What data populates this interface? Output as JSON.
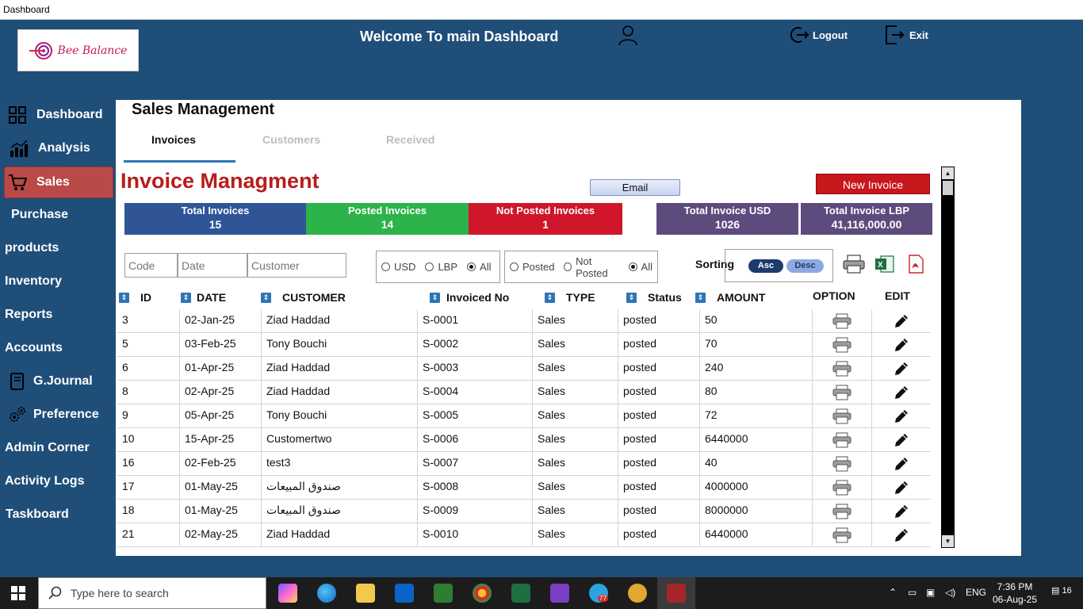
{
  "window": {
    "title": "Dashboard"
  },
  "header": {
    "logo_text": "Bee Balance",
    "welcome": "Welcome To main Dashboard",
    "logout": "Logout",
    "exit": "Exit"
  },
  "sidebar": {
    "items": [
      {
        "label": "Dashboard",
        "icon": "grid-icon"
      },
      {
        "label": "Analysis",
        "icon": "chart-icon"
      },
      {
        "label": "Sales",
        "icon": "cart-icon",
        "active": true
      },
      {
        "label": "Purchase",
        "icon": ""
      },
      {
        "label": "products",
        "icon": ""
      },
      {
        "label": "Inventory",
        "icon": ""
      },
      {
        "label": "Reports",
        "icon": ""
      },
      {
        "label": "Accounts",
        "icon": ""
      },
      {
        "label": "G.Journal",
        "icon": "book-icon"
      },
      {
        "label": "Preference",
        "icon": "gears-icon"
      },
      {
        "label": "Admin Corner",
        "icon": ""
      },
      {
        "label": "Activity Logs",
        "icon": ""
      },
      {
        "label": "Taskboard",
        "icon": ""
      }
    ]
  },
  "main": {
    "section_title": "Sales Management",
    "tabs": [
      {
        "label": "Invoices",
        "active": true
      },
      {
        "label": "Customers",
        "active": false
      },
      {
        "label": "Received",
        "active": false
      }
    ],
    "invoice_title": "Invoice Managment",
    "email_button": "Email",
    "new_invoice_button": "New Invoice",
    "stats": [
      {
        "label": "Total Invoices",
        "value": "15",
        "color": "#2f5597"
      },
      {
        "label": "Posted Invoices",
        "value": "14",
        "color": "#2cb34a"
      },
      {
        "label": "Not Posted Invoices",
        "value": "1",
        "color": "#d0162b"
      },
      {
        "label": "Total Invoice USD",
        "value": "1026",
        "color": "#5e4b7d"
      },
      {
        "label": "Total Invoice LBP",
        "value": "41,116,000.00",
        "color": "#5e4b7d"
      }
    ],
    "filters": {
      "code_placeholder": "Code",
      "date_placeholder": "Date",
      "customer_placeholder": "Customer",
      "currency": [
        {
          "label": "USD",
          "checked": false
        },
        {
          "label": "LBP",
          "checked": false
        },
        {
          "label": "All",
          "checked": true
        }
      ],
      "status": [
        {
          "label": "Posted",
          "checked": false
        },
        {
          "label": "Not Posted",
          "checked": false
        },
        {
          "label": "All",
          "checked": true
        }
      ],
      "sorting_label": "Sorting",
      "asc": "Asc",
      "desc": "Desc"
    },
    "columns": {
      "id": "ID",
      "date": "DATE",
      "customer": "CUSTOMER",
      "invoiced_no": "Invoiced No",
      "type": "TYPE",
      "status": "Status",
      "amount": "AMOUNT",
      "option": "OPTION",
      "edit": "EDIT"
    },
    "rows": [
      {
        "id": "3",
        "date": "02-Jan-25",
        "customer": "Ziad Haddad",
        "invoiced_no": "S-0001",
        "type": "Sales",
        "status": "posted",
        "amount": "50"
      },
      {
        "id": "5",
        "date": "03-Feb-25",
        "customer": "Tony Bouchi",
        "invoiced_no": "S-0002",
        "type": "Sales",
        "status": "posted",
        "amount": "70"
      },
      {
        "id": "6",
        "date": "01-Apr-25",
        "customer": "Ziad Haddad",
        "invoiced_no": "S-0003",
        "type": "Sales",
        "status": "posted",
        "amount": "240"
      },
      {
        "id": "8",
        "date": "02-Apr-25",
        "customer": "Ziad Haddad",
        "invoiced_no": "S-0004",
        "type": "Sales",
        "status": "posted",
        "amount": "80"
      },
      {
        "id": "9",
        "date": "05-Apr-25",
        "customer": "Tony Bouchi",
        "invoiced_no": "S-0005",
        "type": "Sales",
        "status": "posted",
        "amount": "72"
      },
      {
        "id": "10",
        "date": "15-Apr-25",
        "customer": "Customertwo",
        "invoiced_no": "S-0006",
        "type": "Sales",
        "status": "posted",
        "amount": "6440000"
      },
      {
        "id": "16",
        "date": "02-Feb-25",
        "customer": "test3",
        "invoiced_no": "S-0007",
        "type": "Sales",
        "status": "posted",
        "amount": "40"
      },
      {
        "id": "17",
        "date": "01-May-25",
        "customer": "صندوق المبيعات",
        "invoiced_no": "S-0008",
        "type": "Sales",
        "status": "posted",
        "amount": "4000000"
      },
      {
        "id": "18",
        "date": "01-May-25",
        "customer": "صندوق المبيعات",
        "invoiced_no": "S-0009",
        "type": "Sales",
        "status": "posted",
        "amount": "8000000"
      },
      {
        "id": "21",
        "date": "02-May-25",
        "customer": "Ziad Haddad",
        "invoiced_no": "S-0010",
        "type": "Sales",
        "status": "posted",
        "amount": "6440000"
      }
    ]
  },
  "taskbar": {
    "search_placeholder": "Type here to search",
    "language": "ENG",
    "time": "7:36 PM",
    "date": "06-Aug-25",
    "notification_count": "16",
    "telegram_badge": "77"
  }
}
